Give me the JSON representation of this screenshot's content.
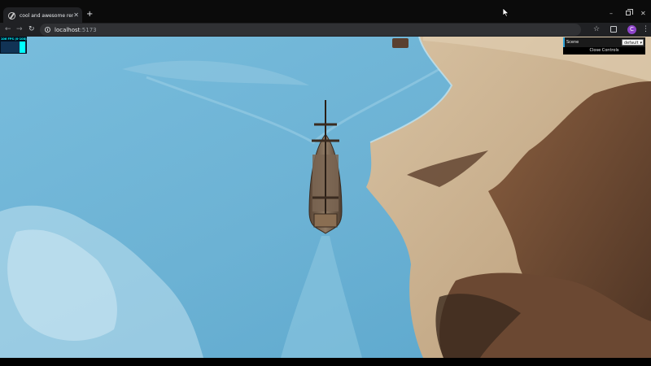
{
  "browser": {
    "tab": {
      "title": "cool and awesome renderer",
      "close_glyph": "✕",
      "icon": "globe-icon"
    },
    "new_tab_glyph": "+",
    "window_controls": {
      "minimize_glyph": "–",
      "close_glyph": "✕"
    },
    "toolbar": {
      "back_glyph": "←",
      "forward_glyph": "→",
      "reload_glyph": "↻",
      "bookmark_glyph": "☆",
      "menu_glyph": "⋮",
      "profile_initial": "C"
    },
    "address": {
      "host": "localhost",
      "port": ":5173"
    }
  },
  "app": {
    "stats": {
      "label": "106 FPS (0-108)",
      "fps": 106,
      "range": [
        0,
        108
      ]
    },
    "controls": {
      "scene_label": "Scene",
      "scene_value": "default",
      "close_label": "Close Controls"
    }
  },
  "colors": {
    "water": "#6db4d6",
    "sand": "#c9ae8c",
    "rock": "#6e4b33",
    "accent": "#2fa1d6",
    "stats_fg": "#00ffff",
    "stats_bg": "#021020"
  }
}
